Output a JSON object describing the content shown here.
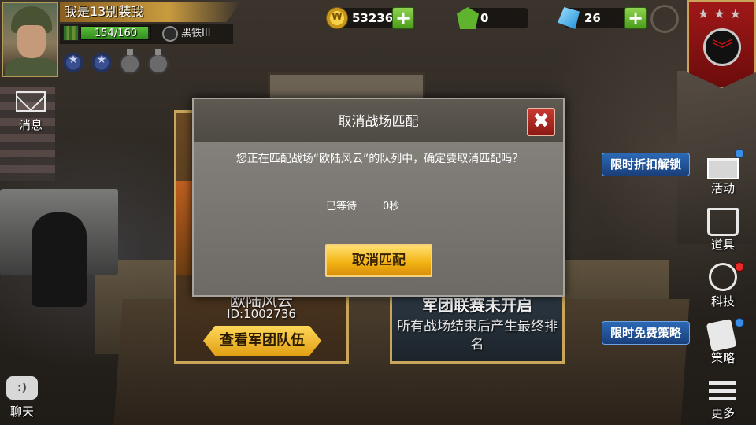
{
  "player": {
    "name": "我是13别装我",
    "exp_text": "154/160",
    "exp_fraction": 0.9625,
    "rank_label": "黑铁III"
  },
  "currencies": {
    "gold": "53236",
    "gems": "0",
    "crystals": "26"
  },
  "left_menu": {
    "mail_label": "消息",
    "chat_label": "聊天"
  },
  "right_menu": {
    "discount_tag": "限时折扣解锁",
    "events_label": "活动",
    "items_label": "道具",
    "tech_label": "科技",
    "free_strategy_tag": "限时免费策略",
    "strategy_label": "策略",
    "more_label": "更多"
  },
  "background_cards": {
    "left_title": "欧陆风云",
    "left_id": "ID:1002736",
    "view_team_label": "查看军团队伍",
    "right_title": "军团联赛未开启",
    "right_desc": "所有战场结束后产生最终排名"
  },
  "dialog": {
    "title": "取消战场匹配",
    "close_glyph": "✖",
    "message": "您正在匹配战场“欧陆风云”的队列中，确定要取消匹配吗？",
    "wait_label": "已等待",
    "wait_value": "0秒",
    "confirm_label": "取消匹配"
  },
  "colors": {
    "accent_gold": "#f3b416",
    "close_red": "#c83a32",
    "plus_green": "#5cbf3a",
    "promo_blue": "#2c69b5"
  }
}
